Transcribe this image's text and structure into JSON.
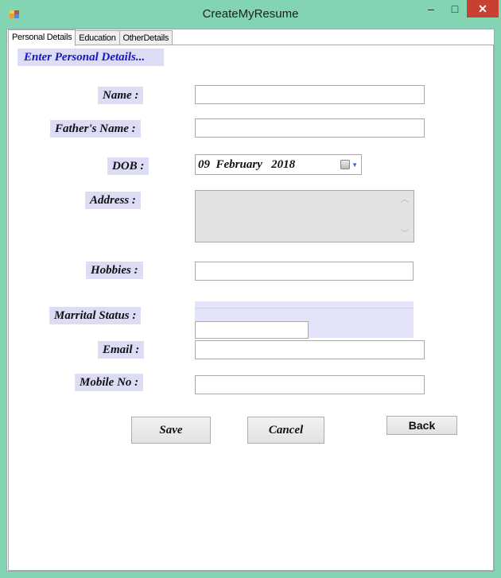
{
  "window": {
    "title": "CreateMyResume",
    "controls": {
      "minimize": "–",
      "maximize": "□",
      "close": "✕"
    }
  },
  "tabs": [
    {
      "label": "Personal Details",
      "active": true
    },
    {
      "label": "Education",
      "active": false
    },
    {
      "label": "OtherDetails",
      "active": false
    }
  ],
  "form": {
    "heading": "Enter Personal Details...",
    "labels": {
      "name": "Name  :",
      "father": "Father's Name :",
      "dob": "DOB :",
      "address": "Address :",
      "hobbies": "Hobbies :",
      "marital": "Marrital Status :",
      "email": "Email :",
      "mobile": "Mobile No :"
    },
    "values": {
      "name": "",
      "father": "",
      "address": "",
      "hobbies": "",
      "email": "",
      "mobile": ""
    },
    "dob": {
      "day": "09",
      "month": "February",
      "year": "2018"
    }
  },
  "buttons": {
    "save": "Save",
    "cancel": "Cancel",
    "back": "Back"
  },
  "icons": {
    "app": "app-icon",
    "calendar": "calendar-icon"
  },
  "colors": {
    "window_frame": "#82d4b3",
    "label_bg": "#dcdcf5",
    "heading_text": "#1515c8",
    "close_button": "#c84031"
  }
}
